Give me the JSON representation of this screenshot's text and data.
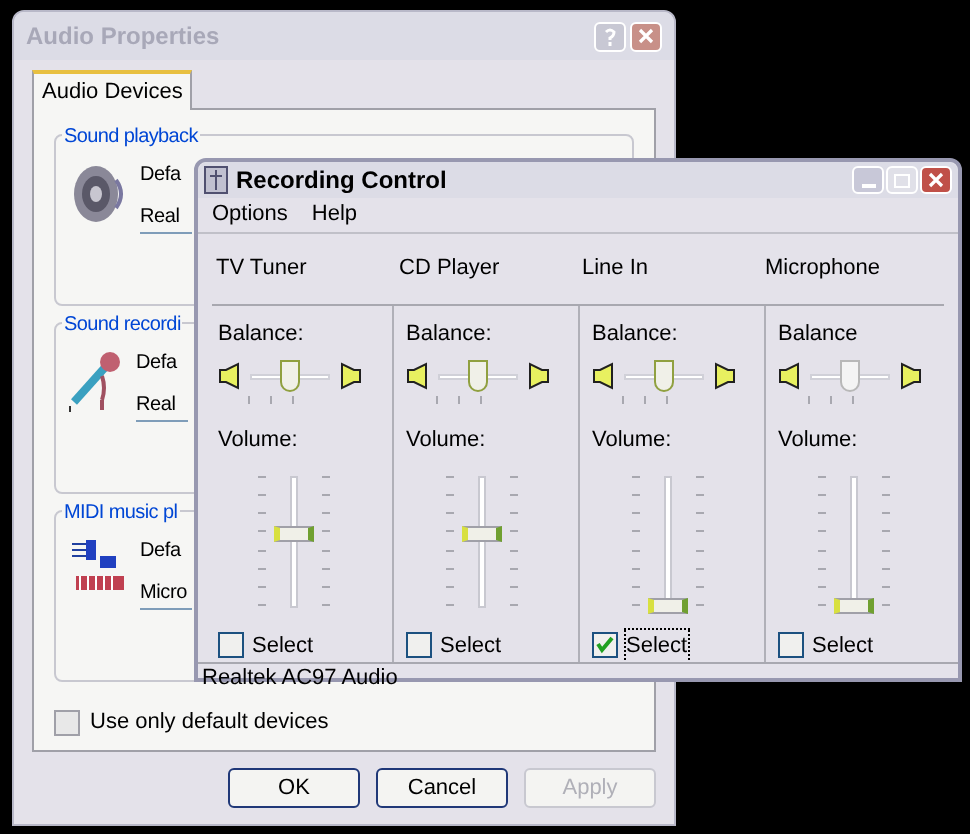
{
  "audio_properties": {
    "title": "Audio Properties",
    "tabs": [
      {
        "label": "Audio Devices",
        "selected": true
      }
    ],
    "groups": [
      {
        "kind": "playback",
        "title": "Sound playback",
        "default_label": "Defa",
        "device": "Real"
      },
      {
        "kind": "recording",
        "title": "Sound recordi",
        "default_label": "Defa",
        "device": "Real"
      },
      {
        "kind": "midi",
        "title": "MIDI music pl",
        "default_label": "Defa",
        "device": "Micro"
      }
    ],
    "default_only": {
      "label": "Use only default devices",
      "checked": false
    },
    "buttons": [
      {
        "label": "OK",
        "disabled": false
      },
      {
        "label": "Cancel",
        "disabled": false
      },
      {
        "label": "Apply",
        "disabled": true
      }
    ]
  },
  "recording_control": {
    "title": "Recording Control",
    "menu": [
      "Options",
      "Help"
    ],
    "channels": [
      {
        "name": "TV Tuner",
        "balance_label": "Balance:",
        "balance": {
          "level": 0.5,
          "disabled": false
        },
        "volume_label": "Volume:",
        "volume": {
          "level": 0.55
        },
        "select_label": "Select",
        "checked": false
      },
      {
        "name": "CD Player",
        "balance_label": "Balance:",
        "balance": {
          "level": 0.5,
          "disabled": false
        },
        "volume_label": "Volume:",
        "volume": {
          "level": 0.55
        },
        "select_label": "Select",
        "checked": false
      },
      {
        "name": "Line In",
        "balance_label": "Balance:",
        "balance": {
          "level": 0.5,
          "disabled": false
        },
        "volume_label": "Volume:",
        "volume": {
          "level": 0.0
        },
        "select_label": "Select",
        "checked": true
      },
      {
        "name": "Microphone",
        "balance_label": "Balance",
        "balance": {
          "level": 0.5,
          "disabled": true
        },
        "volume_label": "Volume:",
        "volume": {
          "level": 0.0
        },
        "select_label": "Select",
        "checked": false
      }
    ],
    "status_bar": "Realtek AC97 Audio"
  }
}
